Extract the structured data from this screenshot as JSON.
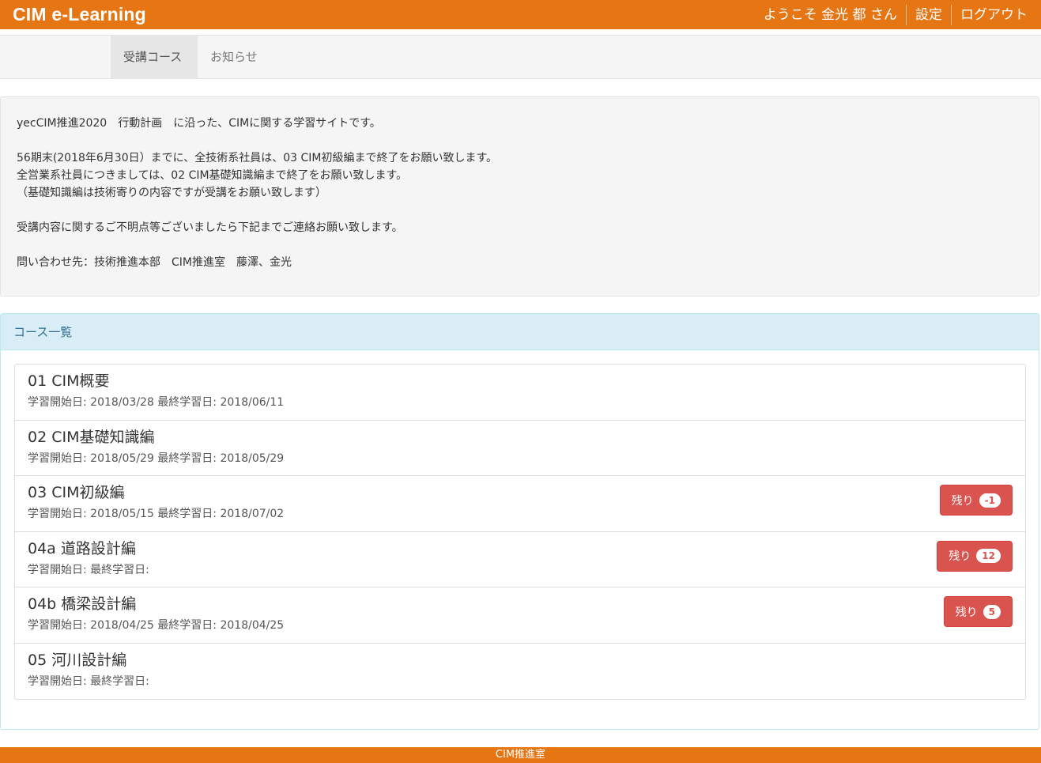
{
  "header": {
    "brand": "CIM e-Learning",
    "welcome": "ようこそ 金光 都 さん",
    "settings": "設定",
    "logout": "ログアウト"
  },
  "tabs": [
    {
      "label": "受講コース",
      "active": true
    },
    {
      "label": "お知らせ",
      "active": false
    }
  ],
  "info": {
    "line1": "yecCIM推進2020　行動計画　に沿った、CIMに関する学習サイトです。",
    "line2": "56期末(2018年6月30日）までに、全技術系社員は、03 CIM初級編まで終了をお願い致します。",
    "line3": "全営業系社員につきましては、02 CIM基礎知識編まで終了をお願い致します。",
    "line4": "（基礎知識編は技術寄りの内容ですが受講をお願い致します）",
    "line5": "受講内容に関するご不明点等ございましたら下記までご連絡お願い致します。",
    "line6": "問い合わせ先：技術推進本部　CIM推進室　藤澤、金光"
  },
  "courses": {
    "heading": "コース一覧",
    "items": [
      {
        "title": "01 CIM概要",
        "dates": "学習開始日: 2018/03/28 最終学習日: 2018/06/11"
      },
      {
        "title": "02 CIM基礎知識編",
        "dates": "学習開始日: 2018/05/29 最終学習日: 2018/05/29"
      },
      {
        "title": "03 CIM初級編",
        "dates": "学習開始日: 2018/05/15 最終学習日: 2018/07/02",
        "remain_label": "残り",
        "remain_count": "-1"
      },
      {
        "title": "04a 道路設計編",
        "dates": "学習開始日: 最終学習日:",
        "remain_label": "残り",
        "remain_count": "12"
      },
      {
        "title": "04b 橋梁設計編",
        "dates": "学習開始日: 2018/04/25 最終学習日: 2018/04/25",
        "remain_label": "残り",
        "remain_count": "5"
      },
      {
        "title": "05 河川設計編",
        "dates": "学習開始日: 最終学習日:"
      }
    ]
  },
  "footer": {
    "text": "CIM推進室"
  },
  "colors": {
    "brand_orange": "#e67614",
    "danger": "#d9534f",
    "info_bg": "#d9edf7",
    "info_text": "#31708f"
  }
}
